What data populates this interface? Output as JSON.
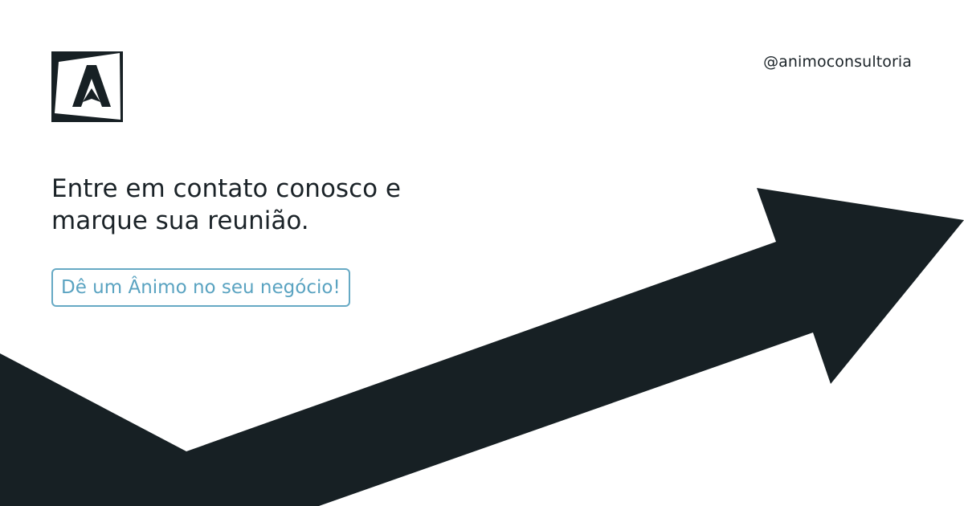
{
  "brand": {
    "logo_icon": "animo-a-logo-icon",
    "handle": "@animoconsultoria"
  },
  "headline": {
    "line1": "Entre em contato conosco e",
    "line2": "marque sua reunião."
  },
  "cta": {
    "label": "Dê um Ânimo no seu negócio!"
  },
  "decoration": {
    "arrow_icon": "trend-up-arrow-icon"
  },
  "colors": {
    "background": "#ffffff",
    "dark": "#172024",
    "accent": "#5aa3c1"
  }
}
